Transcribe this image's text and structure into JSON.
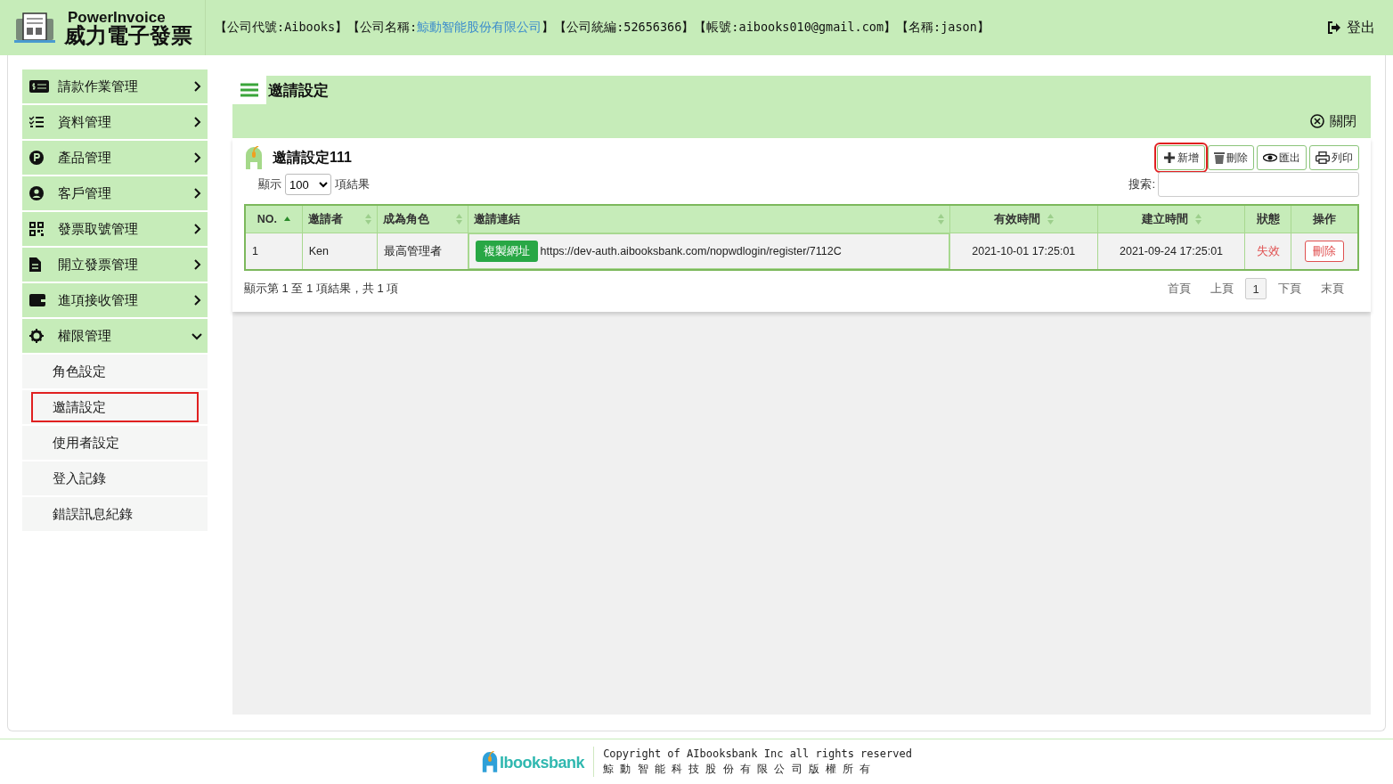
{
  "header": {
    "brand": "PowerInvoice",
    "brand_sub": "威力電子發票",
    "info": [
      {
        "prefix": "【公司代號:",
        "value": "Aibooks",
        "suffix": "】",
        "link": false
      },
      {
        "prefix": "【公司名稱:",
        "value": "鯨動智能股份有限公司",
        "suffix": "】",
        "link": true
      },
      {
        "prefix": "【公司統編:",
        "value": "52656366",
        "suffix": "】",
        "link": false
      },
      {
        "prefix": "【帳號:",
        "value": "aibooks010@gmail.com",
        "suffix": "】",
        "link": false
      },
      {
        "prefix": "【名稱:",
        "value": "jason",
        "suffix": "】",
        "link": false
      }
    ],
    "logout": "登出"
  },
  "sidebar": {
    "items": [
      {
        "kind": "bill",
        "label": "請款作業管理",
        "expanded": false
      },
      {
        "kind": "list",
        "label": "資料管理",
        "expanded": false
      },
      {
        "kind": "p",
        "label": "產品管理",
        "expanded": false
      },
      {
        "kind": "user",
        "label": "客戶管理",
        "expanded": false
      },
      {
        "kind": "qr",
        "label": "發票取號管理",
        "expanded": false
      },
      {
        "kind": "doc",
        "label": "開立發票管理",
        "expanded": false
      },
      {
        "kind": "wallet",
        "label": "進項接收管理",
        "expanded": false
      },
      {
        "kind": "gear",
        "label": "權限管理",
        "expanded": true,
        "children": [
          {
            "label": "角色設定",
            "selected": false
          },
          {
            "label": "邀請設定",
            "selected": true
          },
          {
            "label": "使用者設定",
            "selected": false
          },
          {
            "label": "登入記錄",
            "selected": false
          },
          {
            "label": "錯誤訊息紀錄",
            "selected": false
          }
        ]
      }
    ]
  },
  "panel": {
    "title": "邀請設定",
    "close": "關閉"
  },
  "card": {
    "title": "邀請設定111",
    "toolbar": [
      {
        "kind": "add",
        "label": "新增",
        "highlighted": true
      },
      {
        "kind": "trash",
        "label": "刪除",
        "highlighted": false
      },
      {
        "kind": "eye",
        "label": "匯出",
        "highlighted": false
      },
      {
        "kind": "print",
        "label": "列印",
        "highlighted": false
      }
    ],
    "show_label": "顯示",
    "page_size": "100",
    "results_label": "項結果",
    "search_label": "搜索:",
    "table": {
      "columns": [
        {
          "label": "NO.",
          "sortable": true,
          "sorted": true
        },
        {
          "label": "邀請者",
          "sortable": true,
          "sorted": false
        },
        {
          "label": "成為角色",
          "sortable": true,
          "sorted": false
        },
        {
          "label": "邀請連結",
          "sortable": true,
          "sorted": false
        },
        {
          "label": "有效時間",
          "sortable": true,
          "sorted": false
        },
        {
          "label": "建立時間",
          "sortable": true,
          "sorted": false
        },
        {
          "label": "狀態",
          "sortable": false
        },
        {
          "label": "操作",
          "sortable": false
        }
      ],
      "rows": [
        {
          "no": "1",
          "inviter": "Ken",
          "role": "最高管理者",
          "copy": "複製網址",
          "link": "https://dev-auth.aibooksbank.com/nopwdlogin/register/7112C",
          "valid": "2021-10-01 17:25:01",
          "created": "2021-09-24 17:25:01",
          "status": "失效",
          "active": false,
          "action": "刪除"
        }
      ]
    },
    "summary": "顯示第 1 至 1 項結果，共 1 項",
    "pagination": [
      {
        "label": "首頁",
        "kind": "nav",
        "selected": false
      },
      {
        "label": "上頁",
        "kind": "nav",
        "selected": false
      },
      {
        "label": "1",
        "kind": "page",
        "selected": true
      },
      {
        "label": "下頁",
        "kind": "nav",
        "selected": false
      },
      {
        "label": "末頁",
        "kind": "nav",
        "selected": false
      }
    ]
  },
  "footer": {
    "logo": "Ibooksbank",
    "copyright": "Copyright of AIbooksbank Inc all rights reserved",
    "company": "鯨 動 智 能 科 技 股 份 有 限 公 司 版 權 所 有"
  }
}
